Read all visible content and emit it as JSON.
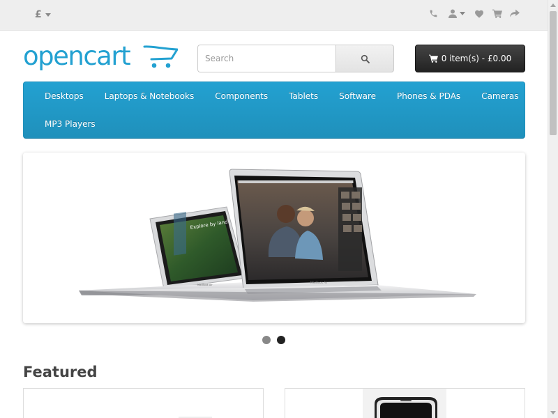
{
  "top_bar": {
    "currency_symbol": "£",
    "icons": [
      "phone-icon",
      "user-icon",
      "heart-icon",
      "shopping-cart-icon",
      "share-icon"
    ]
  },
  "header": {
    "logo": "opencart",
    "search": {
      "placeholder": "Search",
      "value": ""
    },
    "cart_label": "0 item(s) - £0.00"
  },
  "menu": {
    "items": [
      "Desktops",
      "Laptops & Notebooks",
      "Components",
      "Tablets",
      "Software",
      "Phones & PDAs",
      "Cameras",
      "MP3 Players"
    ]
  },
  "slideshow": {
    "slide_count": 2,
    "active_slide": 2,
    "laptop_text": {
      "screen_caption": "Explore by land",
      "left_brand": "MacBook Air",
      "right_brand": "MacBook Air"
    }
  },
  "featured": {
    "title": "Featured"
  },
  "colors": {
    "accent": "#229ac8",
    "logo": "#23a1d1",
    "topbar_bg": "#eeeeee",
    "cart_bg": "#333333"
  }
}
